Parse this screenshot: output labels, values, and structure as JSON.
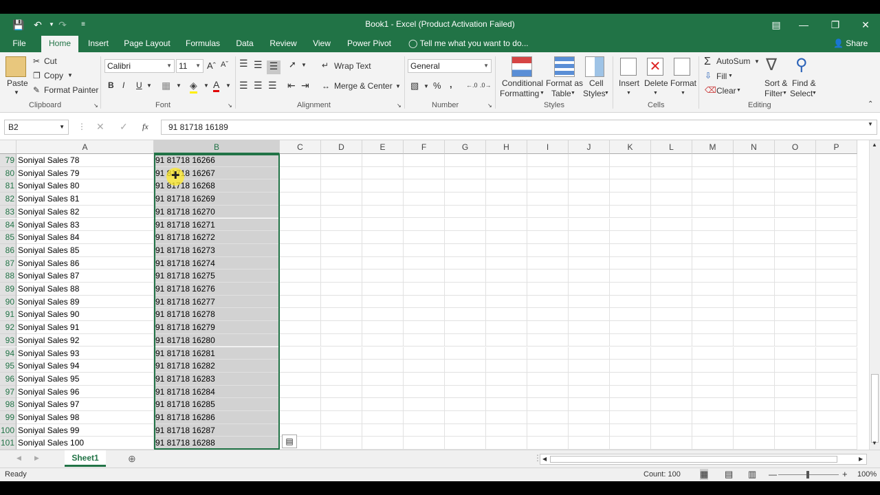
{
  "titlebar": {
    "title": "Book1 - Excel (Product Activation Failed)",
    "save_icon": "save-icon",
    "undo_icon": "undo-icon",
    "redo_icon": "redo-icon"
  },
  "tabs": [
    "File",
    "Home",
    "Insert",
    "Page Layout",
    "Formulas",
    "Data",
    "Review",
    "View",
    "Power Pivot"
  ],
  "tell_me": "Tell me what you want to do...",
  "share": "Share",
  "ribbon": {
    "clipboard": {
      "paste": "Paste",
      "cut": "Cut",
      "copy": "Copy",
      "format_painter": "Format Painter",
      "label": "Clipboard"
    },
    "font": {
      "name": "Calibri",
      "size": "11",
      "bold": "B",
      "italic": "I",
      "underline": "U",
      "label": "Font"
    },
    "alignment": {
      "wrap_text": "Wrap Text",
      "merge_center": "Merge & Center",
      "label": "Alignment"
    },
    "number": {
      "format": "General",
      "percent": "%",
      "comma": ",",
      "label": "Number"
    },
    "styles": {
      "conditional": "Conditional",
      "conditional2": "Formatting",
      "format_as": "Format as",
      "format_as2": "Table",
      "cell": "Cell",
      "cell2": "Styles",
      "label": "Styles"
    },
    "cells": {
      "insert": "Insert",
      "delete": "Delete",
      "format": "Format",
      "label": "Cells"
    },
    "editing": {
      "autosum": "AutoSum",
      "fill": "Fill",
      "clear": "Clear",
      "sort": "Sort &",
      "sort2": "Filter",
      "find": "Find &",
      "find2": "Select",
      "label": "Editing"
    }
  },
  "formula_bar": {
    "name_box": "B2",
    "fx": "fx",
    "value": "91 81718 16189"
  },
  "columns": [
    "A",
    "B",
    "C",
    "D",
    "E",
    "F",
    "G",
    "H",
    "I",
    "J",
    "K",
    "L",
    "M",
    "N",
    "O",
    "P"
  ],
  "rows": [
    {
      "n": "79",
      "a": "Soniyal Sales 78",
      "b": "91 81718 16266"
    },
    {
      "n": "80",
      "a": "Soniyal Sales 79",
      "b": "91 81718 16267"
    },
    {
      "n": "81",
      "a": "Soniyal Sales 80",
      "b": "91 81718 16268"
    },
    {
      "n": "82",
      "a": "Soniyal Sales 81",
      "b": "91 81718 16269"
    },
    {
      "n": "83",
      "a": "Soniyal Sales 82",
      "b": "91 81718 16270"
    },
    {
      "n": "84",
      "a": "Soniyal Sales 83",
      "b": "91 81718 16271"
    },
    {
      "n": "85",
      "a": "Soniyal Sales 84",
      "b": "91 81718 16272"
    },
    {
      "n": "86",
      "a": "Soniyal Sales 85",
      "b": "91 81718 16273"
    },
    {
      "n": "87",
      "a": "Soniyal Sales 86",
      "b": "91 81718 16274"
    },
    {
      "n": "88",
      "a": "Soniyal Sales 87",
      "b": "91 81718 16275"
    },
    {
      "n": "89",
      "a": "Soniyal Sales 88",
      "b": "91 81718 16276"
    },
    {
      "n": "90",
      "a": "Soniyal Sales 89",
      "b": "91 81718 16277"
    },
    {
      "n": "91",
      "a": "Soniyal Sales 90",
      "b": "91 81718 16278"
    },
    {
      "n": "92",
      "a": "Soniyal Sales 91",
      "b": "91 81718 16279"
    },
    {
      "n": "93",
      "a": "Soniyal Sales 92",
      "b": "91 81718 16280"
    },
    {
      "n": "94",
      "a": "Soniyal Sales 93",
      "b": "91 81718 16281"
    },
    {
      "n": "95",
      "a": "Soniyal Sales 94",
      "b": "91 81718 16282"
    },
    {
      "n": "96",
      "a": "Soniyal Sales 95",
      "b": "91 81718 16283"
    },
    {
      "n": "97",
      "a": "Soniyal Sales 96",
      "b": "91 81718 16284"
    },
    {
      "n": "98",
      "a": "Soniyal Sales 97",
      "b": "91 81718 16285"
    },
    {
      "n": "99",
      "a": "Soniyal Sales 98",
      "b": "91 81718 16286"
    },
    {
      "n": "100",
      "a": "Soniyal Sales 99",
      "b": "91 81718 16287"
    },
    {
      "n": "101",
      "a": "Soniyal Sales 100",
      "b": "91 81718 16288"
    }
  ],
  "sheet": {
    "tab": "Sheet1"
  },
  "status": {
    "ready": "Ready",
    "count": "Count: 100",
    "zoom": "100%"
  },
  "colors": {
    "excel_green": "#217346",
    "selection_fill": "#d2d2d2",
    "highlight": "#ffeb28"
  }
}
